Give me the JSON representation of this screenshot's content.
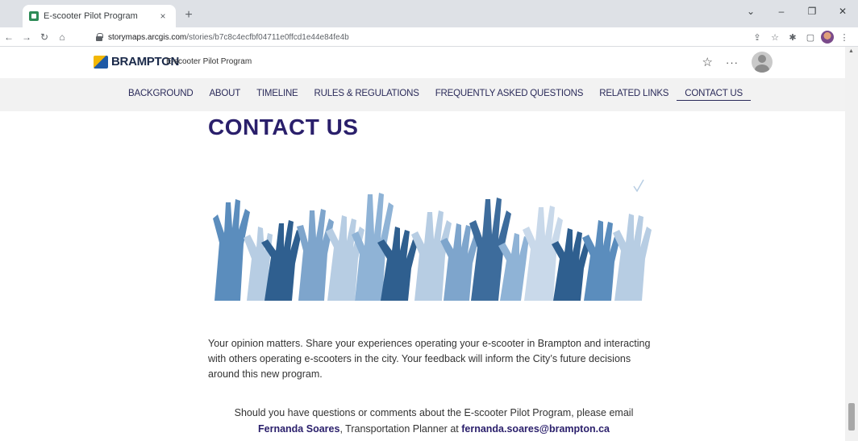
{
  "browser": {
    "tab_title": "E-scooter Pilot Program",
    "tab_close": "×",
    "new_tab": "+",
    "url_host": "storymaps.arcgis.com",
    "url_path": "/stories/b7c8c4ecfbf04711e0ffcd1e44e84fe4b",
    "window_controls": [
      "⌄",
      "–",
      "❐",
      "✕"
    ]
  },
  "site": {
    "logo_text": "BRAMPTON",
    "subtitle": "E-scooter Pilot Program",
    "star": "☆",
    "more": "···"
  },
  "nav": {
    "items": [
      "BACKGROUND",
      "ABOUT",
      "TIMELINE",
      "RULES & REGULATIONS",
      "FREQUENTLY ASKED QUESTIONS",
      "RELATED LINKS",
      "CONTACT US"
    ],
    "active": "CONTACT US"
  },
  "content": {
    "heading": "CONTACT US",
    "paragraph": "Your opinion matters. Share your experiences operating your e-scooter in Brampton and interacting with others operating e-scooters in the city. Your feedback will inform the City’s future decisions around this new program.",
    "contact_intro": "Should you have questions or comments about the E-scooter Pilot Program, please email",
    "contact_name": "Fernanda Soares",
    "contact_role": ", Transportation Planner at ",
    "contact_email": "fernanda.soares@brampton.ca"
  },
  "colors": {
    "heading": "#2a1f6b",
    "nav_bg": "#f2f2f2",
    "hands_dark": "#2f5f8f",
    "hands_mid": "#5b8dbd",
    "hands_light": "#b7cde3"
  }
}
